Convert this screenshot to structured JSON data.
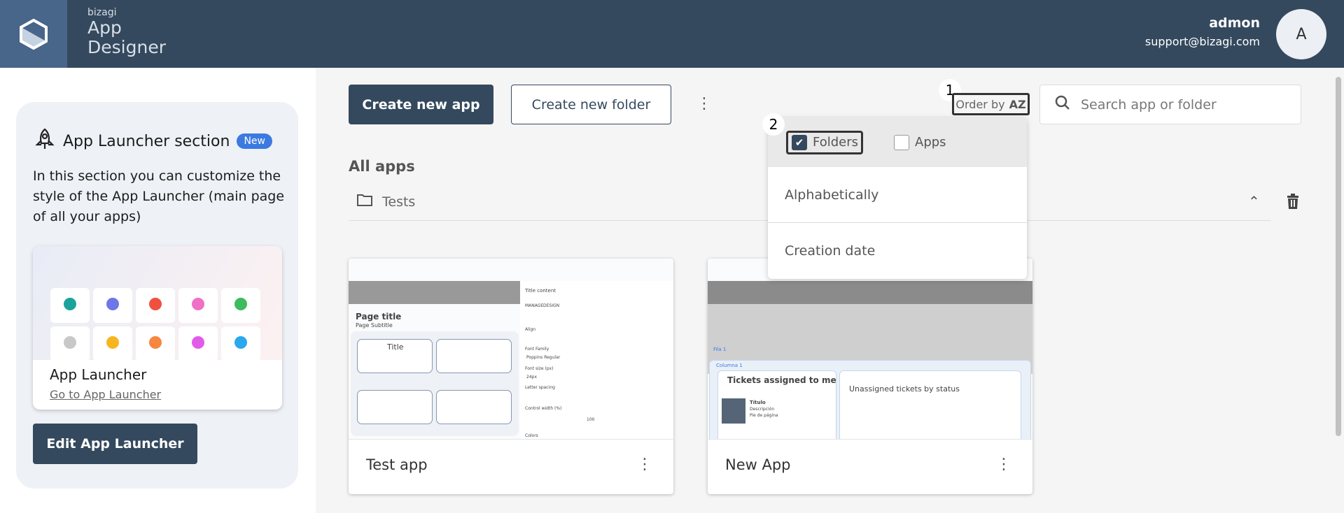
{
  "header": {
    "brand_small": "bizagi",
    "brand_line1": "App",
    "brand_line2": "Designer",
    "user_name": "admon",
    "user_email": "support@bizagi.com",
    "avatar_initial": "A"
  },
  "sidebar": {
    "title": "App Launcher section",
    "badge": "New",
    "description": "In this section you can customize the style of the App Launcher (main page of all your apps)",
    "preview_title": "App Launcher",
    "preview_link": "Go to App Launcher",
    "edit_button": "Edit App Launcher"
  },
  "toolbar": {
    "create_app": "Create new app",
    "create_folder": "Create new folder",
    "order_by": "Order by",
    "order_icon": "AZ",
    "search_placeholder": "Search app or folder"
  },
  "annotations": {
    "step1": "1",
    "step2": "2"
  },
  "dropdown": {
    "folders": "Folders",
    "folders_checked": true,
    "apps": "Apps",
    "apps_checked": false,
    "options": [
      "Alphabetically",
      "Creation date"
    ]
  },
  "main": {
    "section_title": "All apps",
    "folder_name": "Tests"
  },
  "apps": [
    {
      "name": "Test app",
      "thumb": {
        "page_title": "Page title",
        "page_subtitle": "Page Subtitle",
        "tile_title": "Title",
        "panel_title": "Title content",
        "tab1": "MANAGE",
        "tab2": "DESIGN",
        "align": "Align",
        "font_family": "Font Family",
        "font_value": "Poppins Regular",
        "font_size": "Font size (px)",
        "size_value": "24px",
        "letter": "Letter spacing",
        "control": "Control width (%)",
        "control_value": "100",
        "colors": "Colors"
      }
    },
    {
      "name": "New App",
      "thumb": {
        "row": "Fila 1",
        "column": "Columna 1",
        "tickets": "Tickets assigned to me",
        "unassigned": "Unassigned tickets by status",
        "item_title": "Título",
        "item_desc": "Descripción",
        "item_foot": "Pie de página"
      }
    }
  ],
  "colors": {
    "header": "#34495e",
    "accent": "#3b7ae0",
    "logo_bg": "#48658a"
  }
}
